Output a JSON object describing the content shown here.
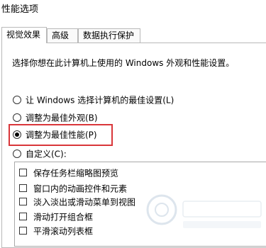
{
  "window": {
    "title": "性能选项"
  },
  "tabs": [
    {
      "label": "视觉效果",
      "active": true
    },
    {
      "label": "高级",
      "active": false
    },
    {
      "label": "数据执行保护",
      "active": false
    }
  ],
  "main": {
    "description": "选择你想在此计算机上使用的 Windows 外观和性能设置。",
    "options": [
      {
        "label": "让 Windows 选择计算机的最佳设置(L)",
        "checked": false
      },
      {
        "label": "调整为最佳外观(B)",
        "checked": false
      },
      {
        "label": "调整为最佳性能(P)",
        "checked": true
      },
      {
        "label": "自定义(C):",
        "checked": false
      }
    ],
    "effects": [
      {
        "label": "保存任务栏缩略图预览",
        "checked": false
      },
      {
        "label": "窗口内的动画控件和元素",
        "checked": false
      },
      {
        "label": "淡入淡出或滑动菜单到视图",
        "checked": false
      },
      {
        "label": "滑动打开组合框",
        "checked": false
      },
      {
        "label": "平滑滚动列表框",
        "checked": false
      }
    ]
  },
  "colors": {
    "highlight": "#d9363a",
    "border": "#b9b9b9"
  }
}
